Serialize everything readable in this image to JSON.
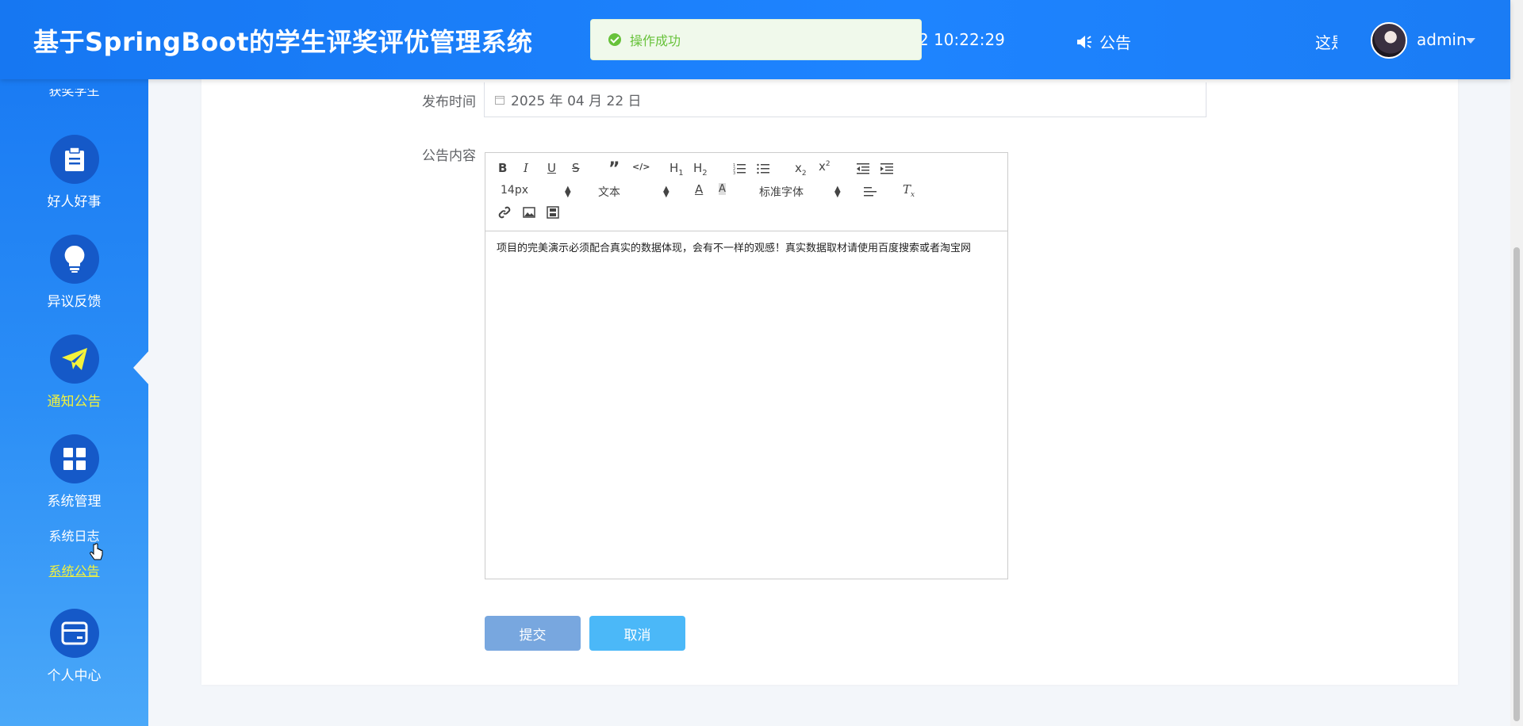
{
  "header": {
    "title": "基于SpringBoot的学生评奖评优管理系统",
    "toast": "操作成功",
    "clock": "2 10:22:29",
    "notice_label": "公告",
    "link_partial": "这是",
    "user_name": "admin"
  },
  "sidebar": {
    "partial_item": "获奖学生",
    "items": [
      {
        "label": "好人好事",
        "icon": "clipboard-icon"
      },
      {
        "label": "异议反馈",
        "icon": "lightbulb-icon"
      },
      {
        "label": "通知公告",
        "icon": "paper-plane-icon"
      },
      {
        "label": "系统管理",
        "icon": "grid-icon"
      },
      {
        "label": "个人中心",
        "icon": "wallet-icon"
      }
    ],
    "sub_items": [
      "系统日志",
      "系统公告"
    ]
  },
  "form": {
    "publish_time_label": "发布时间",
    "publish_time_value": "2025 年 04 月 22 日",
    "content_label": "公告内容",
    "editor": {
      "font_size": "14px",
      "block_format": "文本",
      "font_family": "标准字体",
      "content": "项目的完美演示必须配合真实的数据体现，会有不一样的观感！真实数据取材请使用百度搜索或者淘宝网"
    },
    "submit_label": "提交",
    "cancel_label": "取消"
  },
  "colors": {
    "header": "#1e84ff",
    "active": "#f3f23b",
    "toast_text": "#67c23a"
  }
}
